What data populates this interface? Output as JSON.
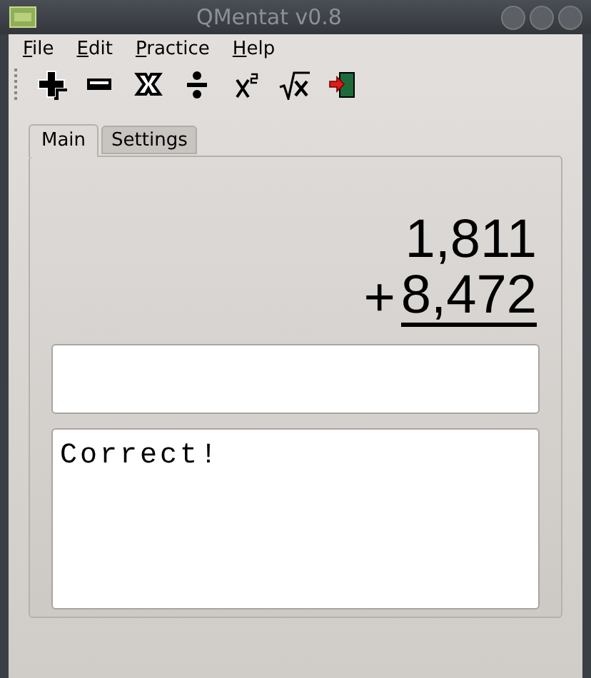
{
  "window": {
    "title": "QMentat v0.8"
  },
  "menu": [
    {
      "label": "File"
    },
    {
      "label": "Edit"
    },
    {
      "label": "Practice"
    },
    {
      "label": "Help"
    }
  ],
  "toolbar": [
    {
      "kind": "add"
    },
    {
      "kind": "subtract"
    },
    {
      "kind": "multiply"
    },
    {
      "kind": "divide"
    },
    {
      "kind": "square"
    },
    {
      "kind": "root"
    },
    {
      "kind": "exit"
    }
  ],
  "tabs": [
    {
      "label": "Main",
      "selected": true
    },
    {
      "label": "Settings",
      "selected": false
    }
  ],
  "problem": {
    "first": "1,811",
    "operator": "+",
    "second": "8,472"
  },
  "feedback": {
    "text": "Correct!"
  }
}
